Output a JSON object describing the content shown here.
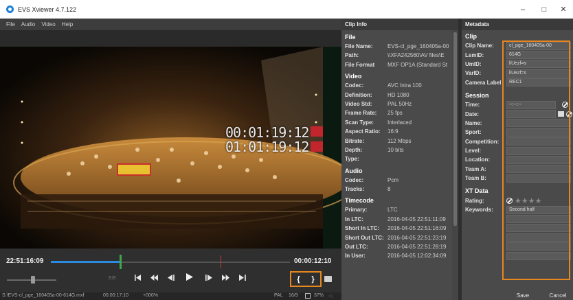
{
  "window": {
    "title": "EVS Xviewer 4.7.122",
    "minimize": "–",
    "maximize": "□",
    "close": "✕"
  },
  "menu": [
    "File",
    "Audio",
    "Video",
    "Help"
  ],
  "player": {
    "overlay_tc_1": "00:01:19:12",
    "overlay_tc_2": "01:01:19:12",
    "current_tc": "22:51:16:09",
    "duration_tc": "00:00:12:10",
    "ee_label": "E/E",
    "playhead_fraction": 0.29,
    "transport_icons": [
      "goto-start-icon",
      "rewind-icon",
      "step-back-icon",
      "play-icon",
      "step-forward-icon",
      "fast-forward-icon",
      "goto-end-icon"
    ],
    "mark_in": "{",
    "mark_out": "}"
  },
  "status": {
    "path": "S:\\EVS-cl_pge_160405a-00-614G.mxf",
    "duration": "00:00:17:10",
    "zoom_speed": "+000%",
    "format": "PAL",
    "aspect": "16/9",
    "zoom": "37%"
  },
  "clip_info": {
    "header": "Clip Info",
    "sections": [
      {
        "title": "File",
        "rows": [
          {
            "k": "File Name:",
            "v": "EVS-cl_pge_160405a-00"
          },
          {
            "k": "Path:",
            "v": "\\\\XFA242560\\AV files\\E"
          },
          {
            "k": "File Format",
            "v": "MXF OP1A (Standard St"
          }
        ]
      },
      {
        "title": "Video",
        "rows": [
          {
            "k": "Codec:",
            "v": "AVC Intra 100"
          },
          {
            "k": "Definition:",
            "v": "HD 1080"
          },
          {
            "k": "Video Std:",
            "v": "PAL 50Hz"
          },
          {
            "k": "Frame Rate:",
            "v": "25 fps"
          },
          {
            "k": "Scan Type:",
            "v": "Interlaced"
          },
          {
            "k": "Aspect Ratio:",
            "v": "16:9"
          },
          {
            "k": "Bitrate:",
            "v": "112 Mbps"
          },
          {
            "k": "Depth:",
            "v": "10 bits"
          },
          {
            "k": "Type:",
            "v": ""
          }
        ]
      },
      {
        "title": "Audio",
        "rows": [
          {
            "k": "Codec:",
            "v": "Pcm"
          },
          {
            "k": "Tracks:",
            "v": "8"
          }
        ]
      },
      {
        "title": "Timecode",
        "rows": [
          {
            "k": "Primary:",
            "v": "LTC"
          },
          {
            "k": "In LTC:",
            "v": "2016-04-05 22:51:11:09"
          },
          {
            "k": "Short In LTC:",
            "v": "2016-04-05 22:51:16:09"
          },
          {
            "k": "Short Out LTC:",
            "v": "2016-04-05 22:51:23:19"
          },
          {
            "k": "Out LTC:",
            "v": "2016-04-05 22:51:28:19"
          },
          {
            "k": "In User:",
            "v": "2016-04-05 12:02:34:09"
          }
        ]
      }
    ]
  },
  "metadata": {
    "header": "Metadata",
    "clip_section": "Clip",
    "clip_rows": [
      {
        "k": "Clip Name:",
        "v": "cl_pge_160405a-00"
      },
      {
        "k": "LsmID:",
        "v": "614G"
      },
      {
        "k": "UmID:",
        "v": "liUezf=s"
      },
      {
        "k": "VarID:",
        "v": "liUezf=s"
      },
      {
        "k": "Camera Label",
        "v": "REC1"
      }
    ],
    "session_section": "Session",
    "time_label": "Time:",
    "time_placeholder": "--:--:--",
    "date_label": "Date:",
    "session_rows": [
      "Name:",
      "Sport:",
      "Competition:",
      "Level:",
      "Location:",
      "Team A:",
      "Team B:"
    ],
    "xt_section": "XT Data",
    "rating_label": "Rating:",
    "rating": 0,
    "rating_max": 4,
    "keywords_label": "Keywords:",
    "keywords": [
      "Second half",
      "",
      "",
      "",
      "",
      ""
    ],
    "save": "Save",
    "cancel": "Cancel"
  }
}
